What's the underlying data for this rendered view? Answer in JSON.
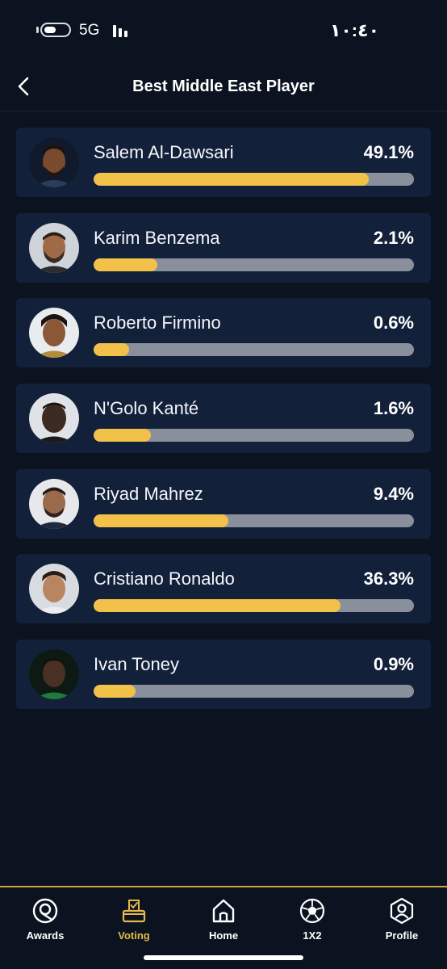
{
  "status_bar": {
    "network": "5G",
    "time": "١٠:٤٠"
  },
  "header": {
    "title": "Best Middle East Player"
  },
  "players": [
    {
      "name": "Salem Al-Dawsari",
      "percent_label": "49.1%",
      "fill_fraction": 0.86
    },
    {
      "name": "Karim Benzema",
      "percent_label": "2.1%",
      "fill_fraction": 0.2
    },
    {
      "name": "Roberto Firmino",
      "percent_label": "0.6%",
      "fill_fraction": 0.11
    },
    {
      "name": "N'Golo Kanté",
      "percent_label": "1.6%",
      "fill_fraction": 0.18
    },
    {
      "name": "Riyad Mahrez",
      "percent_label": "9.4%",
      "fill_fraction": 0.42
    },
    {
      "name": "Cristiano Ronaldo",
      "percent_label": "36.3%",
      "fill_fraction": 0.77
    },
    {
      "name": "Ivan Toney",
      "percent_label": "0.9%",
      "fill_fraction": 0.13
    }
  ],
  "nav": {
    "items": [
      {
        "label": "Awards",
        "icon": "awards-icon",
        "active": false
      },
      {
        "label": "Voting",
        "icon": "ballot-box-icon",
        "active": true
      },
      {
        "label": "Home",
        "icon": "home-icon",
        "active": false
      },
      {
        "label": "1X2",
        "icon": "soccer-ball-icon",
        "active": false
      },
      {
        "label": "Profile",
        "icon": "profile-icon",
        "active": false
      }
    ]
  },
  "colors": {
    "background": "#0b1320",
    "card": "#13203a",
    "accent": "#f2c14a",
    "track": "#8a909b",
    "active_nav": "#e7b84a"
  }
}
